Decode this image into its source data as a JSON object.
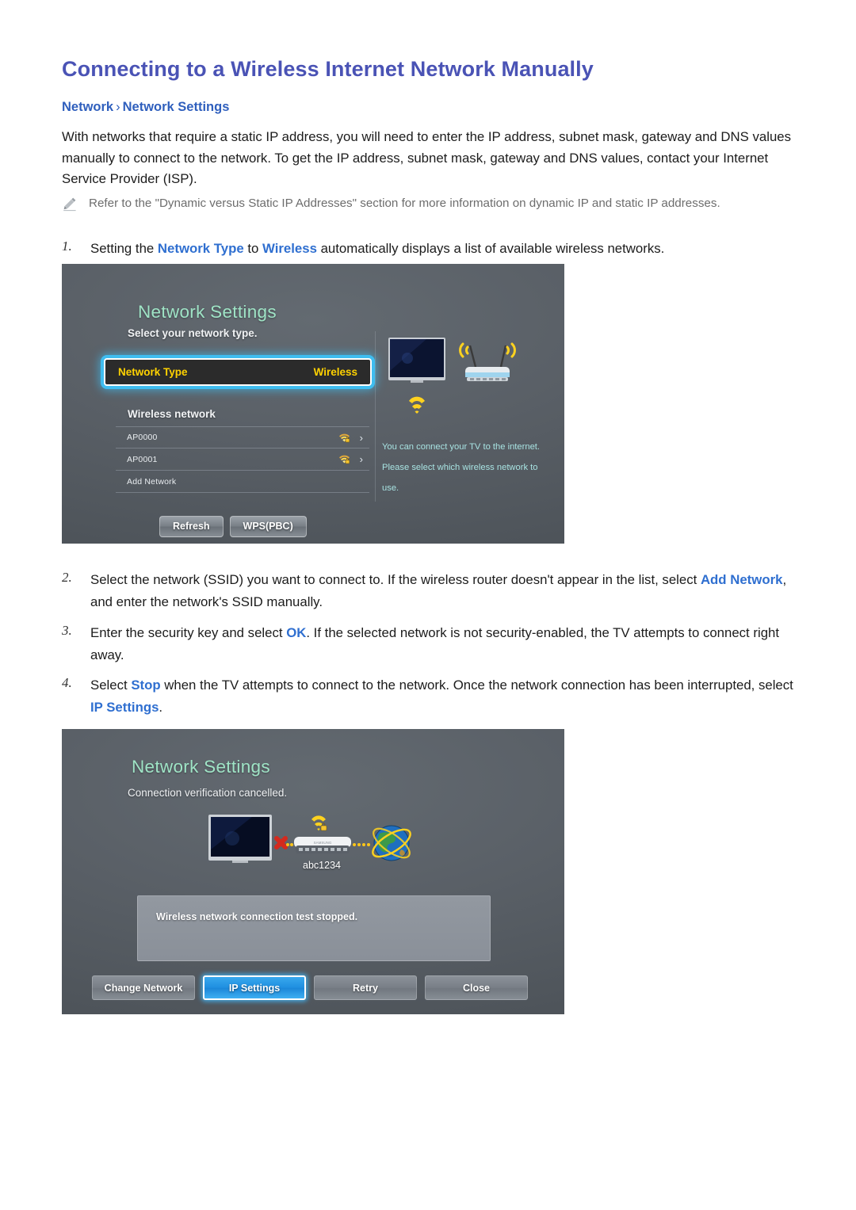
{
  "document": {
    "title": "Connecting to a Wireless Internet Network Manually",
    "breadcrumb": {
      "root": "Network",
      "separator": "›",
      "leaf": "Network Settings"
    },
    "intro": "With networks that require a static IP address, you will need to enter the IP address, subnet mask, gateway and DNS values manually to connect to the network. To get the IP address, subnet mask, gateway and DNS values, contact your Internet Service Provider (ISP).",
    "note": {
      "icon": "pencil-icon",
      "text": "Refer to the \"Dynamic versus Static IP Addresses\" section for more information on dynamic IP and static IP addresses."
    },
    "steps": [
      {
        "num": "1.",
        "text_before": "Setting the ",
        "hl1": "Network Type",
        "text_mid": " to ",
        "hl2": "Wireless",
        "text_after": " automatically displays a list of available wireless networks."
      },
      {
        "num": "2.",
        "text_before": "Select the network (SSID) you want to connect to. If the wireless router doesn't appear in the list, select ",
        "hl1": "Add Network",
        "text_after": ", and enter the network's SSID manually."
      },
      {
        "num": "3.",
        "text_before": "Enter the security key and select ",
        "hl1": "OK",
        "text_after": ". If the selected network is not security-enabled, the TV attempts to connect right away."
      },
      {
        "num": "4.",
        "text_before": "Select ",
        "hl1": "Stop",
        "text_mid": " when the TV attempts to connect to the network. Once the network connection has been interrupted, select ",
        "hl2": "IP Settings",
        "text_after": "."
      }
    ]
  },
  "colors": {
    "title": "#4a53b5",
    "link": "#2f6fd0",
    "breadcrumb": "#2f5fbd",
    "note_text": "#6d6d6d",
    "tv_title": "#9fe4c6",
    "tv_focus_text": "#ffd200",
    "tv_focus_glow": "#3fbdf0",
    "tv_info_text": "#a8e3e2",
    "tv_button_focus": "#1f8fe0"
  },
  "panel1": {
    "title": "Network Settings",
    "subtitle": "Select your network type.",
    "focus_row": {
      "label": "Network Type",
      "value": "Wireless"
    },
    "section_label": "Wireless network",
    "networks": [
      {
        "name": "AP0000",
        "secured": true,
        "icon": "wifi-lock-icon",
        "chevron": "›"
      },
      {
        "name": "AP0001",
        "secured": true,
        "icon": "wifi-lock-icon",
        "chevron": "›"
      },
      {
        "name": "Add Network",
        "secured": false,
        "icon": "",
        "chevron": ""
      }
    ],
    "info_text": "You can connect your TV to the internet. Please select which wireless network to use.",
    "buttons": [
      {
        "label": "Refresh"
      },
      {
        "label": "WPS(PBC)"
      }
    ],
    "diagram": {
      "tv": "tv-icon",
      "router": "wireless-router-icon"
    }
  },
  "panel2": {
    "title": "Network Settings",
    "subtitle": "Connection verification cancelled.",
    "ssid": "abc1234",
    "message": "Wireless network connection test stopped.",
    "diagram": {
      "tv": "tv-icon",
      "link_status": "failed",
      "router": "router-icon",
      "internet": "globe-icon"
    },
    "buttons": [
      {
        "label": "Change Network",
        "focused": false
      },
      {
        "label": "IP Settings",
        "focused": true
      },
      {
        "label": "Retry",
        "focused": false
      },
      {
        "label": "Close",
        "focused": false
      }
    ]
  }
}
